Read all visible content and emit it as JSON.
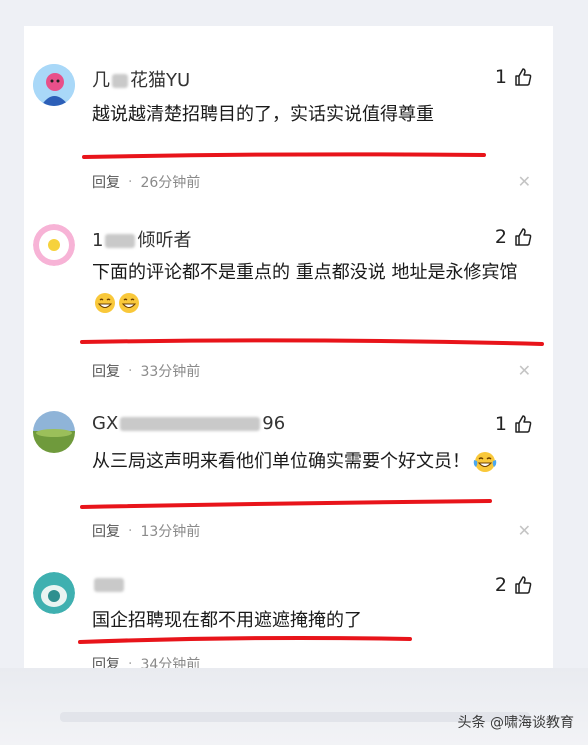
{
  "comments": [
    {
      "name_visible": "花猫YU",
      "name_prefix_visible": "几",
      "text": "越说越清楚招聘目的了，实话实说值得尊重",
      "likes": "1",
      "reply": "回复",
      "time": "26分钟前"
    },
    {
      "name_prefix_visible": "1",
      "name_visible": "倾听者",
      "text_line1": "下面的评论都不是重点的 重点都没说 地址是永修宾馆",
      "likes": "2",
      "reply": "回复",
      "time": "33分钟前"
    },
    {
      "name_prefix_visible": "GX",
      "name_visible": "96",
      "text": "从三局这声明来看他们单位确实需要个好文员！",
      "likes": "1",
      "reply": "回复",
      "time": "13分钟前"
    },
    {
      "name_prefix_visible": "",
      "name_visible": "",
      "text": "国企招聘现在都不用遮遮掩掩的了",
      "likes": "2",
      "reply": "回复",
      "time": "34分钟前"
    }
  ],
  "watermark": "头条 @啸海谈教育",
  "colors": {
    "underline": "#e8141a",
    "background": "#eef0f5"
  }
}
